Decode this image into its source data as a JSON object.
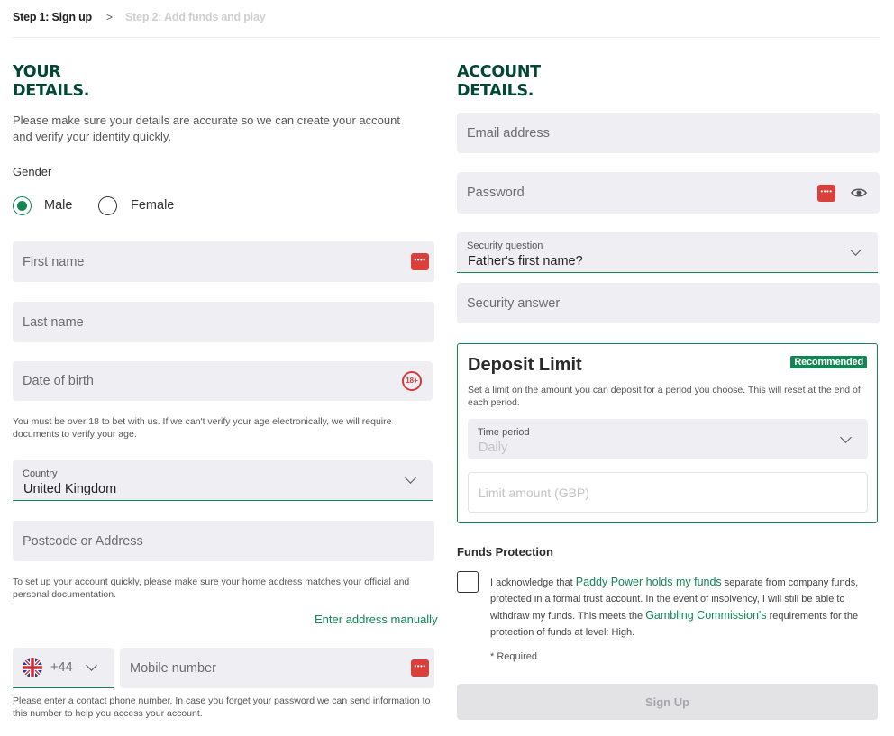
{
  "steps": {
    "step1": "Step 1: Sign up",
    "step2": "Step 2: Add funds and play"
  },
  "your_details": {
    "heading_line1": "YOUR",
    "heading_line2": "DETAILS.",
    "intro": "Please make sure your details are accurate so we can create your account and verify your identity quickly.",
    "gender_label": "Gender",
    "gender_options": [
      "Male",
      "Female"
    ],
    "gender_selected": "Male",
    "first_name_placeholder": "First name",
    "last_name_placeholder": "Last name",
    "dob_placeholder": "Date of birth",
    "age_badge": "18+",
    "age_note": "You must be over 18 to bet with us. If we can't verify your age electronically, we will require documents to verify your age.",
    "country_label": "Country",
    "country_value": "United Kingdom",
    "postcode_placeholder": "Postcode or Address",
    "address_note": "To set up your account quickly, please make sure your home address matches your official and personal documentation.",
    "enter_address_manually": "Enter address manually",
    "phone_code": "+44",
    "mobile_placeholder": "Mobile number",
    "phone_note": "Please enter a contact phone number. In case you forget your password we can send information to this number to help you access your account."
  },
  "account_details": {
    "heading_line1": "ACCOUNT",
    "heading_line2": "DETAILS.",
    "email_placeholder": "Email address",
    "password_placeholder": "Password",
    "security_question_label": "Security question",
    "security_question_value": "Father's first name?",
    "security_answer_placeholder": "Security answer"
  },
  "deposit_limit": {
    "title": "Deposit Limit",
    "badge": "Recommended",
    "description": "Set a limit on the amount you can deposit for a period you choose. This will reset at the end of each period.",
    "time_period_label": "Time period",
    "time_period_value": "Daily",
    "limit_placeholder": "Limit amount (GBP)"
  },
  "funds_protection": {
    "title": "Funds Protection",
    "text_part1": "I acknowledge that ",
    "link1": "Paddy Power holds my funds",
    "text_part2": " separate from company funds, protected in a formal trust account. In the event of insolvency, I will still be able to withdraw my funds. This meets the ",
    "link2": "Gambling Commission's",
    "text_part3": " requirements for the protection of funds at level: High.",
    "required_note": "* Required"
  },
  "signup_label": "Sign Up",
  "colors": {
    "brand_green": "#004833",
    "accent_green": "#128552",
    "field_bg": "#eeeef3",
    "password_icon_red": "#d9403b"
  },
  "icons": [
    "chevron-right-icon",
    "password-manager-icon",
    "age-18-icon",
    "chevron-down-icon",
    "uk-flag-icon",
    "eye-icon"
  ]
}
